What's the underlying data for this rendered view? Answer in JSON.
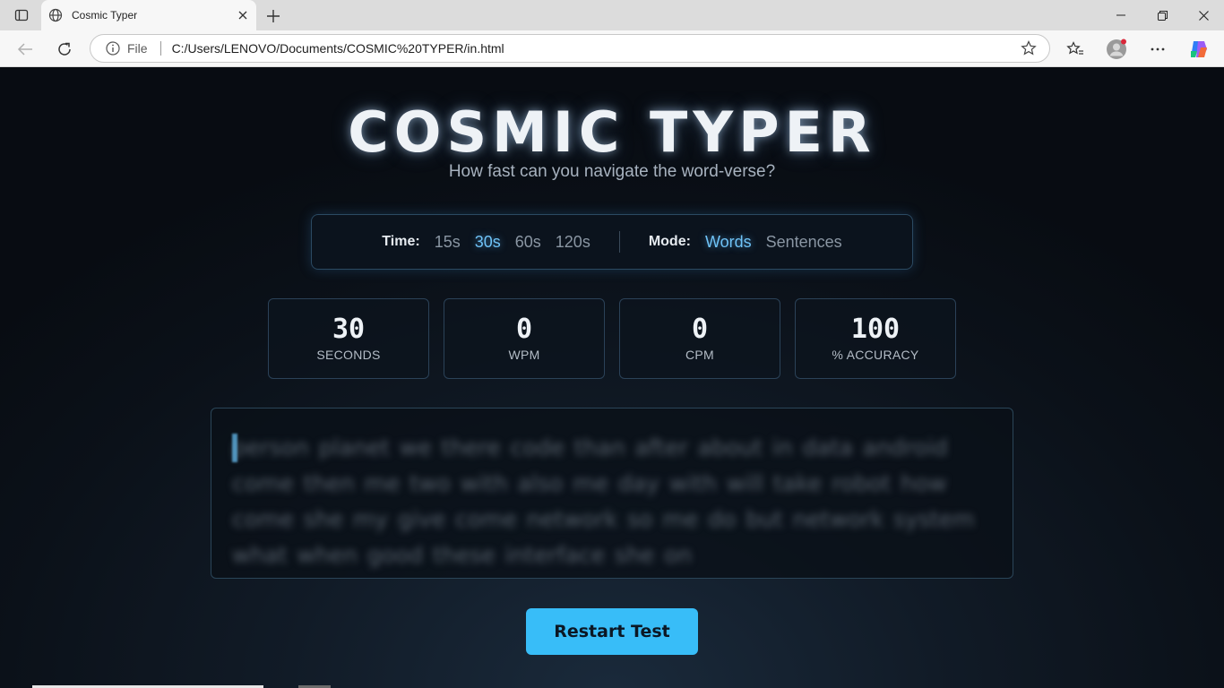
{
  "browser": {
    "tab_title": "Cosmic Typer",
    "address_scheme": "File",
    "address_url": "C:/Users/LENOVO/Documents/COSMIC%20TYPER/in.html"
  },
  "page": {
    "title": "COSMIC TYPER",
    "subtitle": "How fast can you navigate the word-verse?",
    "config": {
      "time_label": "Time:",
      "time_options": [
        "15s",
        "30s",
        "60s",
        "120s"
      ],
      "time_selected": "30s",
      "mode_label": "Mode:",
      "mode_options": [
        "Words",
        "Sentences"
      ],
      "mode_selected": "Words"
    },
    "stats": [
      {
        "value": "30",
        "label": "SECONDS"
      },
      {
        "value": "0",
        "label": "WPM"
      },
      {
        "value": "0",
        "label": "CPM"
      },
      {
        "value": "100",
        "label": "% ACCURACY"
      }
    ],
    "typing_text": "person planet we there code than after about in data android come then me two with also me day with will take robot how come she my give come network so me do but network system what when good these interface she on",
    "restart_label": "Restart Test"
  },
  "colors": {
    "accent": "#38bdf8",
    "active_option": "#6fc3f7"
  }
}
